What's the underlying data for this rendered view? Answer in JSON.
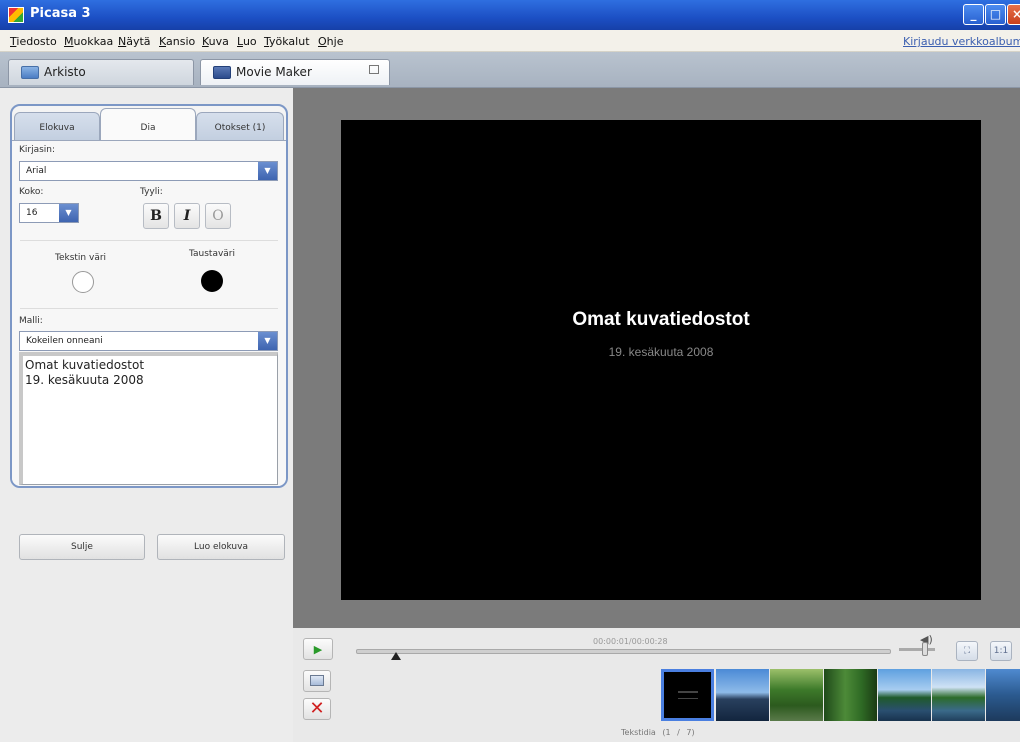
{
  "window": {
    "title": "Picasa 3"
  },
  "menu": {
    "items": [
      "Tiedosto",
      "Muokkaa",
      "Näytä",
      "Kansio",
      "Kuva",
      "Luo",
      "Työkalut",
      "Ohje"
    ],
    "signin": "Kirjaudu verkkoalbumeihin"
  },
  "tabs": {
    "library": "Arkisto",
    "movie_maker": "Movie Maker"
  },
  "editor": {
    "subtabs": [
      "Elokuva",
      "Dia",
      "Otokset (1)"
    ],
    "font_label": "Kirjasin:",
    "font_value": "Arial",
    "size_label": "Koko:",
    "size_value": "16",
    "style_label": "Tyyli:",
    "bold": "B",
    "italic": "I",
    "outline": "O",
    "text_color_label": "Tekstin väri",
    "text_color": "#ffffff",
    "bg_color_label": "Taustaväri",
    "bg_color": "#000000",
    "template_label": "Malli:",
    "template_value": "Kokeilen onneani",
    "text_line1": "Omat kuvatiedostot",
    "text_line2": "19. kesäkuuta 2008"
  },
  "buttons": {
    "close": "Sulje",
    "create_movie": "Luo elokuva"
  },
  "preview": {
    "title": "Omat kuvatiedostot",
    "subtitle": "19. kesäkuuta 2008"
  },
  "player": {
    "time": "00:00:01/00:00:28",
    "status": "Tekstidia (1 / 7)"
  },
  "colors": {
    "accent": "#4a7fe0",
    "titlebar": "#1c4fc4"
  }
}
